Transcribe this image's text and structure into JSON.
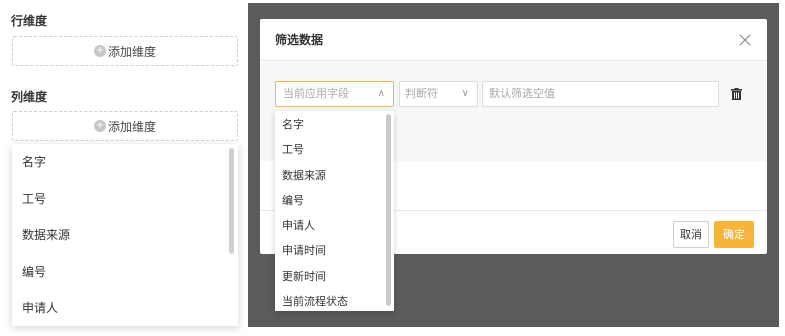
{
  "left": {
    "row_title": "行维度",
    "add_label": "添加维度",
    "col_title": "列维度",
    "dropdown_items": [
      "名字",
      "工号",
      "数据来源",
      "编号",
      "申请人"
    ]
  },
  "modal": {
    "title": "筛选数据",
    "field_placeholder": "当前应用字段",
    "operator_placeholder": "判断符",
    "value_placeholder": "默认筛选空值",
    "cancel_label": "取消",
    "ok_label": "确定",
    "field_options": [
      "名字",
      "工号",
      "数据来源",
      "编号",
      "申请人",
      "申请时间",
      "更新时间",
      "当前流程状态"
    ]
  },
  "colors": {
    "accent": "#f5b43c",
    "overlay": "#5b5b5b"
  }
}
